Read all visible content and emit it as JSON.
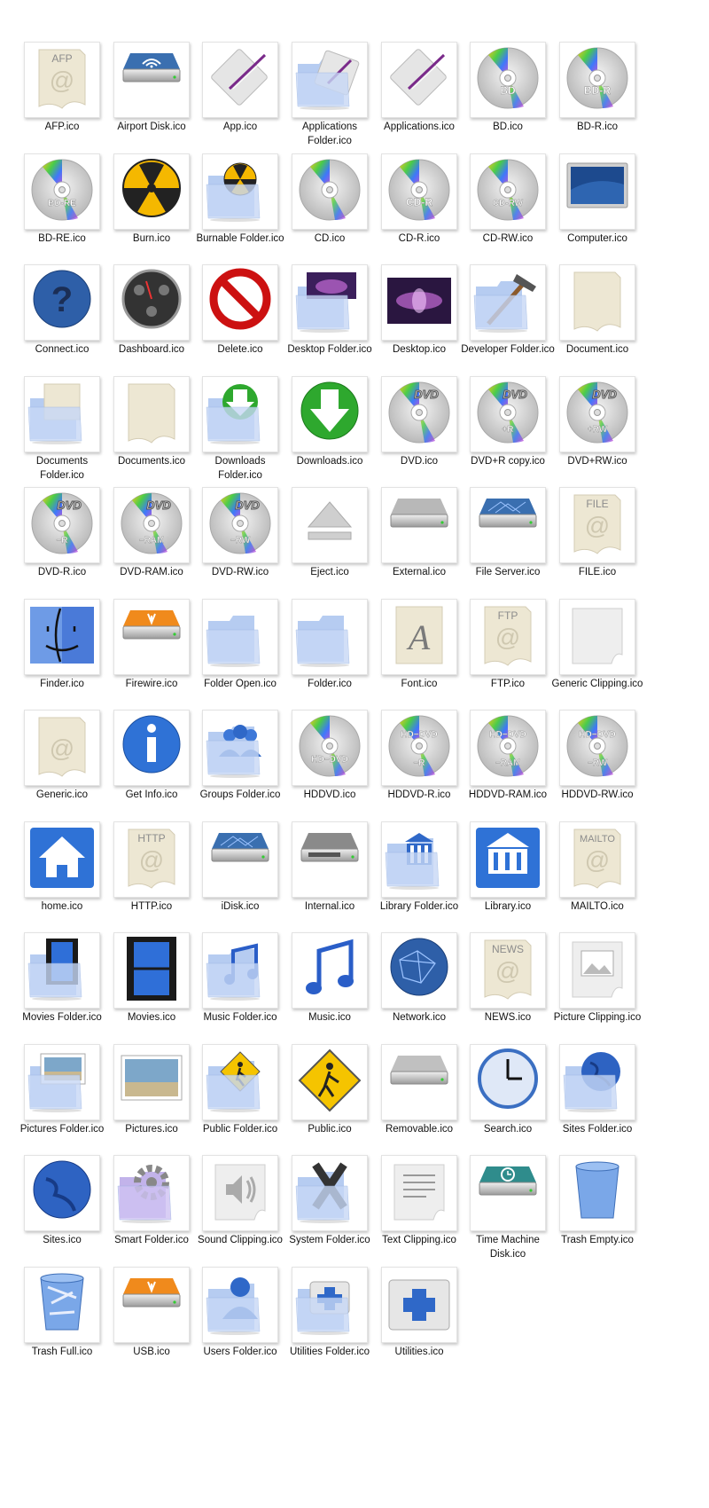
{
  "items": [
    {
      "label": "AFP.ico",
      "icon": "afp-document-icon",
      "kind": "doc",
      "text": "AFP"
    },
    {
      "label": "Airport Disk.ico",
      "icon": "airport-disk-icon",
      "kind": "drive",
      "sub": "wifi",
      "color": "#3a6fb0"
    },
    {
      "label": "App.ico",
      "icon": "app-icon",
      "kind": "app"
    },
    {
      "label": "Applications Folder.ico",
      "icon": "applications-folder-icon",
      "kind": "folder",
      "sub": "app"
    },
    {
      "label": "Applications.ico",
      "icon": "applications-icon",
      "kind": "app"
    },
    {
      "label": "BD.ico",
      "icon": "bd-disc-icon",
      "kind": "disc",
      "text": "BD"
    },
    {
      "label": "BD-R.ico",
      "icon": "bd-r-disc-icon",
      "kind": "disc",
      "text": "BD-R"
    },
    {
      "label": "BD-RE.ico",
      "icon": "bd-re-disc-icon",
      "kind": "disc",
      "text": "BD-RE"
    },
    {
      "label": "Burn.ico",
      "icon": "burn-icon",
      "kind": "burn"
    },
    {
      "label": "Burnable Folder.ico",
      "icon": "burnable-folder-icon",
      "kind": "folder",
      "sub": "burn"
    },
    {
      "label": "CD.ico",
      "icon": "cd-disc-icon",
      "kind": "disc",
      "text": ""
    },
    {
      "label": "CD-R.ico",
      "icon": "cd-r-disc-icon",
      "kind": "disc",
      "text": "CD-R"
    },
    {
      "label": "CD-RW.ico",
      "icon": "cd-rw-disc-icon",
      "kind": "disc",
      "text": "CD-RW"
    },
    {
      "label": "Computer.ico",
      "icon": "computer-icon",
      "kind": "computer"
    },
    {
      "label": "Connect.ico",
      "icon": "connect-icon",
      "kind": "connect"
    },
    {
      "label": "Dashboard.ico",
      "icon": "dashboard-icon",
      "kind": "dashboard"
    },
    {
      "label": "Delete.ico",
      "icon": "delete-icon",
      "kind": "delete"
    },
    {
      "label": "Desktop Folder.ico",
      "icon": "desktop-folder-icon",
      "kind": "folder",
      "sub": "desktop"
    },
    {
      "label": "Desktop.ico",
      "icon": "desktop-icon",
      "kind": "desktop"
    },
    {
      "label": "Developer Folder.ico",
      "icon": "developer-folder-icon",
      "kind": "folder",
      "sub": "hammer"
    },
    {
      "label": "Document.ico",
      "icon": "document-icon",
      "kind": "doc",
      "text": ""
    },
    {
      "label": "Documents Folder.ico",
      "icon": "documents-folder-icon",
      "kind": "folder",
      "sub": "doc"
    },
    {
      "label": "Documents.ico",
      "icon": "documents-icon",
      "kind": "doc",
      "text": ""
    },
    {
      "label": "Downloads Folder.ico",
      "icon": "downloads-folder-icon",
      "kind": "folder",
      "sub": "download"
    },
    {
      "label": "Downloads.ico",
      "icon": "downloads-icon",
      "kind": "download"
    },
    {
      "label": "DVD.ico",
      "icon": "dvd-disc-icon",
      "kind": "dvd",
      "text": ""
    },
    {
      "label": "DVD+R copy.ico",
      "icon": "dvd-plus-r-disc-icon",
      "kind": "dvd",
      "text": "+R"
    },
    {
      "label": "DVD+RW.ico",
      "icon": "dvd-plus-rw-disc-icon",
      "kind": "dvd",
      "text": "+RW"
    },
    {
      "label": "DVD-R.ico",
      "icon": "dvd-minus-r-disc-icon",
      "kind": "dvd",
      "text": "−R"
    },
    {
      "label": "DVD-RAM.ico",
      "icon": "dvd-ram-disc-icon",
      "kind": "dvd",
      "text": "−RAM"
    },
    {
      "label": "DVD-RW.ico",
      "icon": "dvd-minus-rw-disc-icon",
      "kind": "dvd",
      "text": "−RW"
    },
    {
      "label": "Eject.ico",
      "icon": "eject-icon",
      "kind": "eject"
    },
    {
      "label": "External.ico",
      "icon": "external-drive-icon",
      "kind": "drive",
      "sub": "plain",
      "color": "#b8b8b8"
    },
    {
      "label": "File Server.ico",
      "icon": "file-server-icon",
      "kind": "drive",
      "sub": "network",
      "color": "#3a6fb0"
    },
    {
      "label": "FILE.ico",
      "icon": "file-document-icon",
      "kind": "doc",
      "text": "FILE"
    },
    {
      "label": "Finder.ico",
      "icon": "finder-icon",
      "kind": "finder"
    },
    {
      "label": "Firewire.ico",
      "icon": "firewire-drive-icon",
      "kind": "drive",
      "sub": "firewire",
      "color": "#f08a1c"
    },
    {
      "label": "Folder Open.ico",
      "icon": "folder-open-icon",
      "kind": "folder",
      "sub": "open"
    },
    {
      "label": "Folder.ico",
      "icon": "folder-icon",
      "kind": "folder",
      "sub": ""
    },
    {
      "label": "Font.ico",
      "icon": "font-icon",
      "kind": "font"
    },
    {
      "label": "FTP.ico",
      "icon": "ftp-document-icon",
      "kind": "doc",
      "text": "FTP"
    },
    {
      "label": "Generic Clipping.ico",
      "icon": "generic-clipping-icon",
      "kind": "clip",
      "sub": ""
    },
    {
      "label": "Generic.ico",
      "icon": "generic-document-icon",
      "kind": "doc",
      "text": " "
    },
    {
      "label": "Get Info.ico",
      "icon": "get-info-icon",
      "kind": "info"
    },
    {
      "label": "Groups Folder.ico",
      "icon": "groups-folder-icon",
      "kind": "folder",
      "sub": "groups"
    },
    {
      "label": "HDDVD.ico",
      "icon": "hddvd-disc-icon",
      "kind": "disc",
      "text": "HD−DVD",
      "text2": ""
    },
    {
      "label": "HDDVD-R.ico",
      "icon": "hddvd-r-disc-icon",
      "kind": "disc",
      "text": "HD−DVD",
      "text2": "−R"
    },
    {
      "label": "HDDVD-RAM.ico",
      "icon": "hddvd-ram-disc-icon",
      "kind": "disc",
      "text": "HD−DVD",
      "text2": "−RAM"
    },
    {
      "label": "HDDVD-RW.ico",
      "icon": "hddvd-rw-disc-icon",
      "kind": "disc",
      "text": "HD−DVD",
      "text2": "−RW"
    },
    {
      "label": "home.ico",
      "icon": "home-icon",
      "kind": "home"
    },
    {
      "label": "HTTP.ico",
      "icon": "http-document-icon",
      "kind": "doc",
      "text": "HTTP"
    },
    {
      "label": "iDisk.ico",
      "icon": "idisk-icon",
      "kind": "drive",
      "sub": "network",
      "color": "#3a6fb0"
    },
    {
      "label": "Internal.ico",
      "icon": "internal-drive-icon",
      "kind": "drive",
      "sub": "internal",
      "color": "#8a8a8a"
    },
    {
      "label": "Library Folder.ico",
      "icon": "library-folder-icon",
      "kind": "folder",
      "sub": "library"
    },
    {
      "label": "Library.ico",
      "icon": "library-icon",
      "kind": "library"
    },
    {
      "label": "MAILTO.ico",
      "icon": "mailto-document-icon",
      "kind": "doc",
      "text": "MAILTO"
    },
    {
      "label": "Movies Folder.ico",
      "icon": "movies-folder-icon",
      "kind": "folder",
      "sub": "film"
    },
    {
      "label": "Movies.ico",
      "icon": "movies-icon",
      "kind": "film"
    },
    {
      "label": "Music Folder.ico",
      "icon": "music-folder-icon",
      "kind": "folder",
      "sub": "music"
    },
    {
      "label": "Music.ico",
      "icon": "music-icon",
      "kind": "music"
    },
    {
      "label": "Network.ico",
      "icon": "network-icon",
      "kind": "network"
    },
    {
      "label": "NEWS.ico",
      "icon": "news-document-icon",
      "kind": "doc",
      "text": "NEWS"
    },
    {
      "label": "Picture Clipping.ico",
      "icon": "picture-clipping-icon",
      "kind": "clip",
      "sub": "picture"
    },
    {
      "label": "Pictures Folder.ico",
      "icon": "pictures-folder-icon",
      "kind": "folder",
      "sub": "photo"
    },
    {
      "label": "Pictures.ico",
      "icon": "pictures-icon",
      "kind": "photo"
    },
    {
      "label": "Public Folder.ico",
      "icon": "public-folder-icon",
      "kind": "folder",
      "sub": "public"
    },
    {
      "label": "Public.ico",
      "icon": "public-icon",
      "kind": "public"
    },
    {
      "label": "Removable.ico",
      "icon": "removable-drive-icon",
      "kind": "drive",
      "sub": "removable",
      "color": "#c0c0c0"
    },
    {
      "label": "Search.ico",
      "icon": "search-clock-icon",
      "kind": "clock"
    },
    {
      "label": "Sites Folder.ico",
      "icon": "sites-folder-icon",
      "kind": "folder",
      "sub": "globe"
    },
    {
      "label": "Sites.ico",
      "icon": "sites-icon",
      "kind": "globe"
    },
    {
      "label": "Smart Folder.ico",
      "icon": "smart-folder-icon",
      "kind": "folder",
      "sub": "gear",
      "color": "#b7a6e6"
    },
    {
      "label": "Sound Clipping.ico",
      "icon": "sound-clipping-icon",
      "kind": "clip",
      "sub": "sound"
    },
    {
      "label": "System Folder.ico",
      "icon": "system-folder-icon",
      "kind": "folder",
      "sub": "x"
    },
    {
      "label": "Text Clipping.ico",
      "icon": "text-clipping-icon",
      "kind": "clip",
      "sub": "text"
    },
    {
      "label": "Time Machine Disk.ico",
      "icon": "time-machine-disk-icon",
      "kind": "drive",
      "sub": "timemachine",
      "color": "#2f8c8c"
    },
    {
      "label": "Trash Empty.ico",
      "icon": "trash-empty-icon",
      "kind": "trash",
      "sub": "empty"
    },
    {
      "label": "Trash Full.ico",
      "icon": "trash-full-icon",
      "kind": "trash",
      "sub": "full"
    },
    {
      "label": "USB.ico",
      "icon": "usb-drive-icon",
      "kind": "drive",
      "sub": "usb",
      "color": "#f08a1c"
    },
    {
      "label": "Users Folder.ico",
      "icon": "users-folder-icon",
      "kind": "folder",
      "sub": "user"
    },
    {
      "label": "Utilities Folder.ico",
      "icon": "utilities-folder-icon",
      "kind": "folder",
      "sub": "utilities"
    },
    {
      "label": "Utilities.ico",
      "icon": "utilities-icon",
      "kind": "utilities"
    }
  ],
  "colors": {
    "folder_blue": "#a9c3ee",
    "folder_front": "#c7d8f6",
    "disc_silver": "#d8d8d8",
    "doc_paper": "#ede7d3",
    "label_text": "#111111"
  }
}
